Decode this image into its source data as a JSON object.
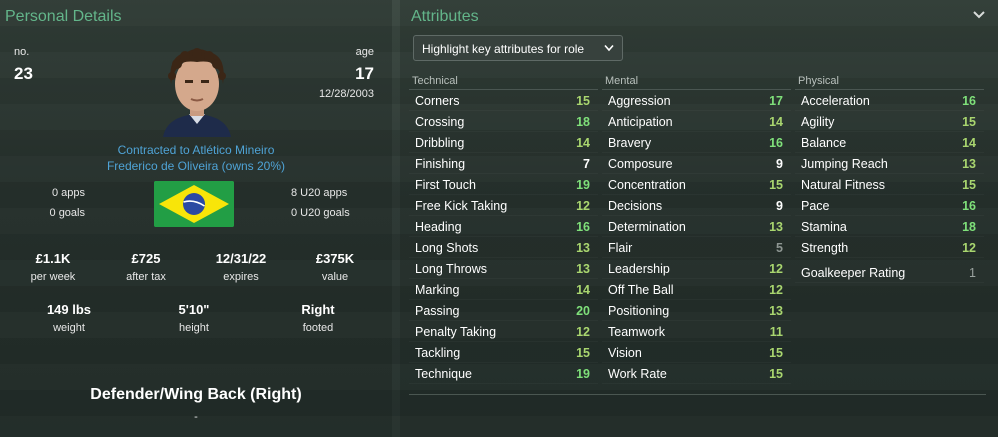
{
  "left": {
    "title": "Personal Details",
    "no_label": "no.",
    "no_value": "23",
    "age_label": "age",
    "age_value": "17",
    "dob": "12/28/2003",
    "contract_line1": "Contracted to Atlético Mineiro",
    "contract_line2": "Frederico de Oliveira (owns 20%)",
    "apps": "0 apps",
    "goals": "0 goals",
    "u20_apps": "8 U20 apps",
    "u20_goals": "0 U20 goals",
    "nationality_flag": "brazil-flag",
    "finance": [
      {
        "value": "£1.1K",
        "label": "per week"
      },
      {
        "value": "£725",
        "label": "after tax"
      },
      {
        "value": "12/31/22",
        "label": "expires"
      },
      {
        "value": "£375K",
        "label": "value"
      }
    ],
    "physique": [
      {
        "value": "149 lbs",
        "label": "weight"
      },
      {
        "value": "5'10\"",
        "label": "height"
      },
      {
        "value": "Right",
        "label": "footed"
      }
    ],
    "position": "Defender/Wing Back (Right)",
    "position_sub": "-"
  },
  "right": {
    "title": "Attributes",
    "dropdown_label": "Highlight key attributes for role",
    "columns": [
      {
        "heading": "Technical",
        "rows": [
          {
            "name": "Corners",
            "value": "15"
          },
          {
            "name": "Crossing",
            "value": "18"
          },
          {
            "name": "Dribbling",
            "value": "14"
          },
          {
            "name": "Finishing",
            "value": "7"
          },
          {
            "name": "First Touch",
            "value": "19"
          },
          {
            "name": "Free Kick Taking",
            "value": "12"
          },
          {
            "name": "Heading",
            "value": "16"
          },
          {
            "name": "Long Shots",
            "value": "13"
          },
          {
            "name": "Long Throws",
            "value": "13"
          },
          {
            "name": "Marking",
            "value": "14"
          },
          {
            "name": "Passing",
            "value": "20"
          },
          {
            "name": "Penalty Taking",
            "value": "12"
          },
          {
            "name": "Tackling",
            "value": "15"
          },
          {
            "name": "Technique",
            "value": "19"
          }
        ]
      },
      {
        "heading": "Mental",
        "rows": [
          {
            "name": "Aggression",
            "value": "17"
          },
          {
            "name": "Anticipation",
            "value": "14"
          },
          {
            "name": "Bravery",
            "value": "16"
          },
          {
            "name": "Composure",
            "value": "9"
          },
          {
            "name": "Concentration",
            "value": "15"
          },
          {
            "name": "Decisions",
            "value": "9"
          },
          {
            "name": "Determination",
            "value": "13"
          },
          {
            "name": "Flair",
            "value": "5"
          },
          {
            "name": "Leadership",
            "value": "12"
          },
          {
            "name": "Off The Ball",
            "value": "12"
          },
          {
            "name": "Positioning",
            "value": "13"
          },
          {
            "name": "Teamwork",
            "value": "11"
          },
          {
            "name": "Vision",
            "value": "15"
          },
          {
            "name": "Work Rate",
            "value": "15"
          }
        ]
      },
      {
        "heading": "Physical",
        "rows": [
          {
            "name": "Acceleration",
            "value": "16"
          },
          {
            "name": "Agility",
            "value": "15"
          },
          {
            "name": "Balance",
            "value": "14"
          },
          {
            "name": "Jumping Reach",
            "value": "13"
          },
          {
            "name": "Natural Fitness",
            "value": "15"
          },
          {
            "name": "Pace",
            "value": "16"
          },
          {
            "name": "Stamina",
            "value": "18"
          },
          {
            "name": "Strength",
            "value": "12"
          }
        ],
        "gk_label": "Goalkeeper Rating",
        "gk_value": "1"
      }
    ]
  },
  "colors": {
    "title_green": "#63b58a",
    "link_blue": "#4fa3d6",
    "val_bright_green": "#7fe07a",
    "val_green": "#a9d66f",
    "val_white": "#ffffff",
    "val_grey": "#8e9692"
  }
}
